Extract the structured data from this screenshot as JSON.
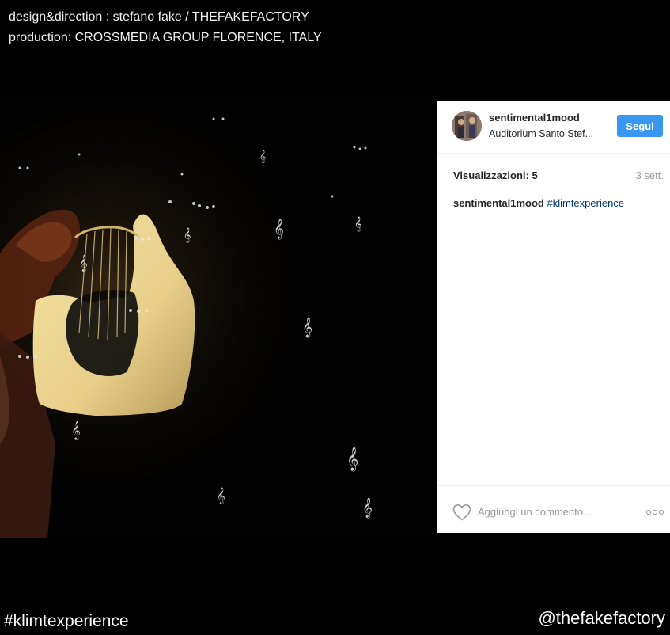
{
  "credits": {
    "line1": "design&direction : stefano fake / THEFAKEFACTORY",
    "line2": "production: CROSSMEDIA GROUP FLORENCE, ITALY"
  },
  "post": {
    "username": "sentimental1mood",
    "location": "Auditorium Santo Stef...",
    "follow_label": "Segui",
    "views_label": "Visualizzazioni: 5",
    "time_ago": "3 sett.",
    "caption_user": "sentimental1mood",
    "caption_hashtag": "#klimtexperience",
    "comment_placeholder": "Aggiungi un commento...",
    "colors": {
      "follow_button": "#3897f0",
      "hashtag": "#003569"
    }
  },
  "icons": {
    "like": "heart-icon",
    "more": "more-options-icon",
    "note": "treble-clef-icon"
  },
  "footer": {
    "hashtag": "#klimtexperience",
    "handle": "@thefakefactory"
  }
}
